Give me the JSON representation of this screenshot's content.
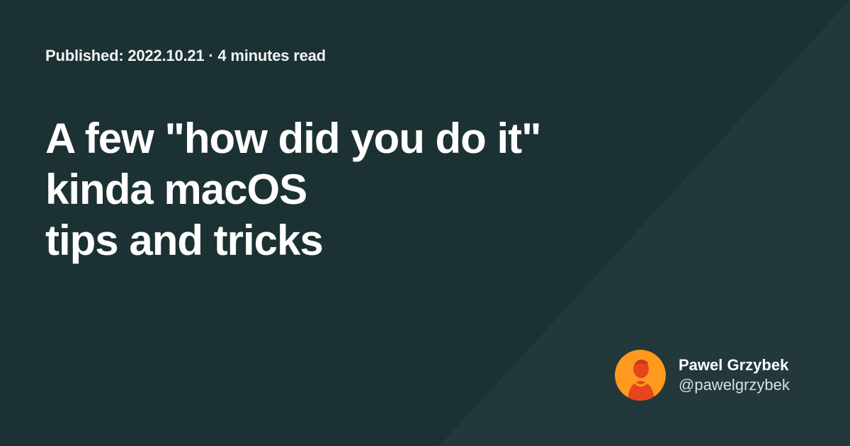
{
  "colors": {
    "background": "#1c3133",
    "highlight": "#233a3c",
    "avatar_orange": "#ff9a1f",
    "avatar_red": "#e7451c"
  },
  "post": {
    "meta": "Published: 2022.10.21 · 4 minutes read",
    "title_lines": [
      "A few \"how did you do it\"",
      "kinda macOS",
      "tips and tricks"
    ]
  },
  "author": {
    "avatar_icon": "author-portrait",
    "name": "Pawel Grzybek",
    "handle": "@pawelgrzybek"
  }
}
